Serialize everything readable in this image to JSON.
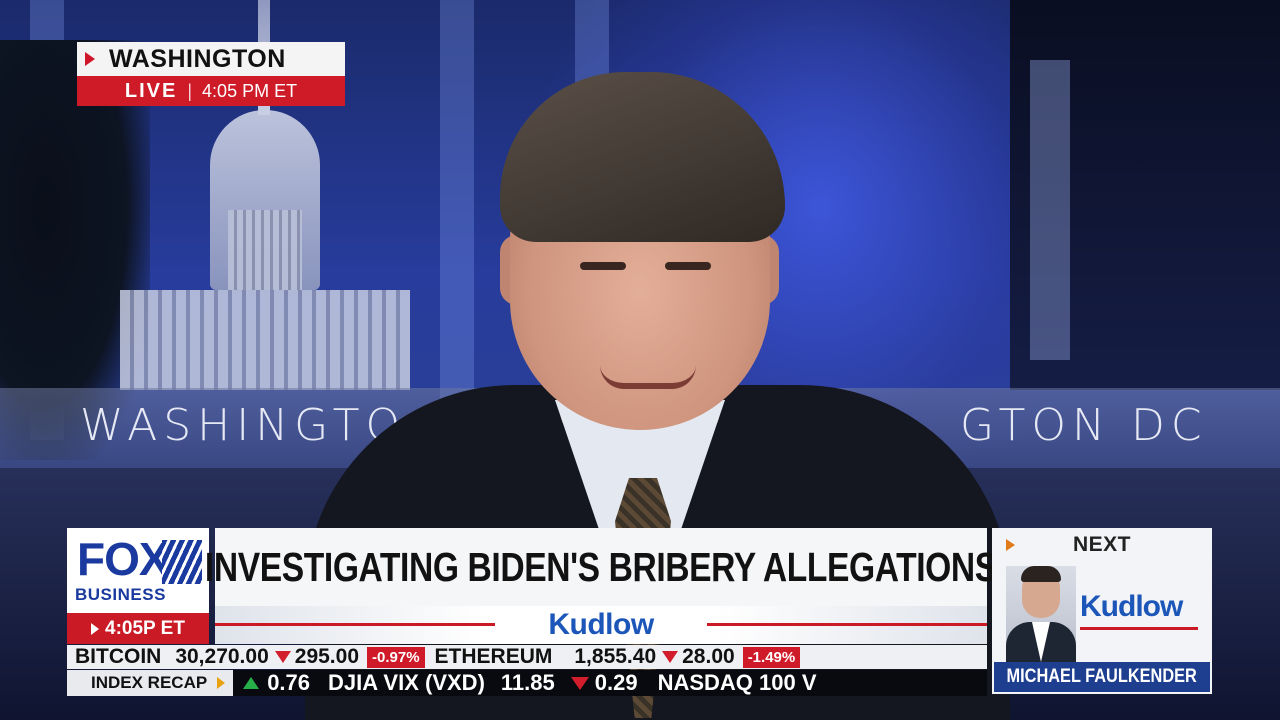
{
  "bug": {
    "location": "WASHINGTON",
    "live_label": "LIVE",
    "separator": "|",
    "time": "4:05 PM ET"
  },
  "set": {
    "wall_text_left": "WASHINGTO",
    "wall_text_right": "GTON DC"
  },
  "network": {
    "logo_main": "FOX",
    "logo_sub": "BUSINESS",
    "brand_color": "#1a3aa0",
    "time": "4:05P ET"
  },
  "lower_third": {
    "headline": "INVESTIGATING BIDEN'S BRIBERY ALLEGATIONS",
    "show_name": "Kudlow",
    "accent_color": "#c91a26"
  },
  "next_up": {
    "label": "NEXT",
    "show_name": "Kudlow",
    "guest_name": "MICHAEL FAULKENDER"
  },
  "ticker_top": [
    {
      "symbol": "BITCOIN",
      "price": "30,270.00",
      "change": "295.00",
      "percent": "-0.97%",
      "direction": "down"
    },
    {
      "symbol": "ETHEREUM",
      "price": "1,855.40",
      "change": "28.00",
      "percent": "-1.49%",
      "direction": "down"
    }
  ],
  "ticker_bottom": {
    "label": "INDEX RECAP",
    "first_change": "0.76",
    "first_direction": "up",
    "second_symbol": "DJIA VIX (VXD)",
    "second_value": "11.85",
    "second_change": "0.29",
    "second_direction": "down",
    "third_symbol": "NASDAQ 100 V"
  }
}
